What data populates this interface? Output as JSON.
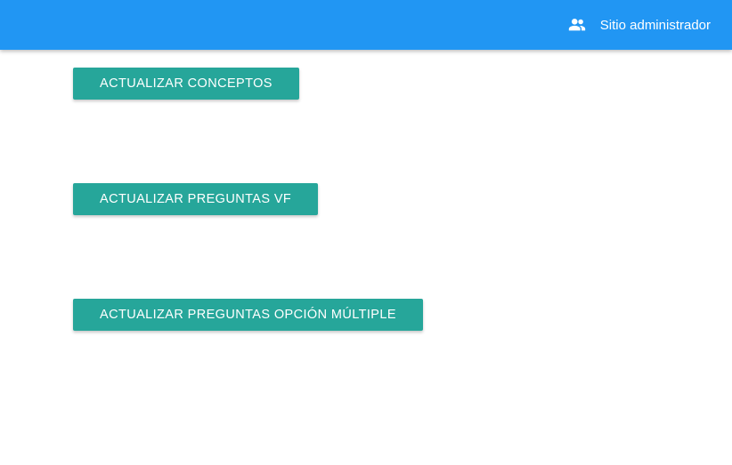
{
  "header": {
    "admin_link": {
      "icon": "people-icon",
      "label": "Sitio administrador"
    }
  },
  "main": {
    "buttons": [
      {
        "label": "ACTUALIZAR CONCEPTOS"
      },
      {
        "label": "ACTUALIZAR PREGUNTAS VF"
      },
      {
        "label": "ACTUALIZAR PREGUNTAS OPCIÓN MÚLTIPLE"
      }
    ]
  },
  "colors": {
    "app_bar": "#2196f3",
    "button": "#26a69a",
    "text_on_color": "#ffffff"
  }
}
